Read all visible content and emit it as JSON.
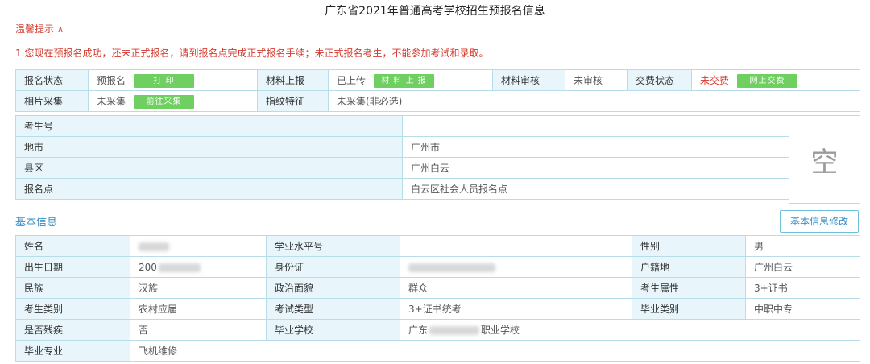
{
  "page_title": "广东省2021年普通高考学校招生预报名信息",
  "tip": {
    "title": "温馨提示",
    "chevron": "chevron-up-icon",
    "message": "1.您现在预报名成功，还未正式报名，请到报名点完成正式报名手续；未正式报名考生，不能参加考试和录取。"
  },
  "status": {
    "reg_status_label": "报名状态",
    "reg_status_value": "预报名",
    "print_button": "打 印",
    "material_upload_label": "材料上报",
    "material_upload_value": "已上传",
    "material_upload_button": "材 料 上 报",
    "material_review_label": "材料审核",
    "material_review_value": "未审核",
    "payment_label": "交费状态",
    "payment_value": "未交费",
    "payment_button": "网上交费",
    "photo_label": "相片采集",
    "photo_value": "未采集",
    "photo_button": "前往采集",
    "fingerprint_label": "指纹特征",
    "fingerprint_value": "未采集(非必选)"
  },
  "exam": {
    "exam_no_label": "考生号",
    "exam_no_value": "",
    "city_label": "地市",
    "city_value": "广州市",
    "county_label": "县区",
    "county_value": "广州白云",
    "site_label": "报名点",
    "site_value": "白云区社会人员报名点",
    "photo_placeholder": "空"
  },
  "basic": {
    "section_title": "基本信息",
    "edit_button": "基本信息修改",
    "name_label": "姓名",
    "level_no_label": "学业水平号",
    "level_no_value": "",
    "gender_label": "性别",
    "gender_value": "男",
    "birth_label": "出生日期",
    "birth_value_prefix": "200",
    "id_label": "身份证",
    "hukou_label": "户籍地",
    "hukou_value": "广州白云",
    "ethnic_label": "民族",
    "ethnic_value": "汉族",
    "political_label": "政治面貌",
    "political_value": "群众",
    "attr_label": "考生属性",
    "attr_value": "3+证书",
    "cat_label": "考生类别",
    "cat_value": "农村应届",
    "exam_type_label": "考试类型",
    "exam_type_value": "3+证书统考",
    "grad_type_label": "毕业类别",
    "grad_type_value": "中职中专",
    "disabled_label": "是否残疾",
    "disabled_value": "否",
    "school_label": "毕业学校",
    "school_prefix": "广东",
    "school_suffix": "职业学校",
    "major_label": "毕业专业",
    "major_value": "飞机维修"
  },
  "colors": {
    "accent_red": "#d23b2f",
    "button_green": "#6fcf60",
    "label_bg": "#e8f6fb",
    "border": "#b7dde9",
    "link_blue": "#3a8fc6"
  }
}
